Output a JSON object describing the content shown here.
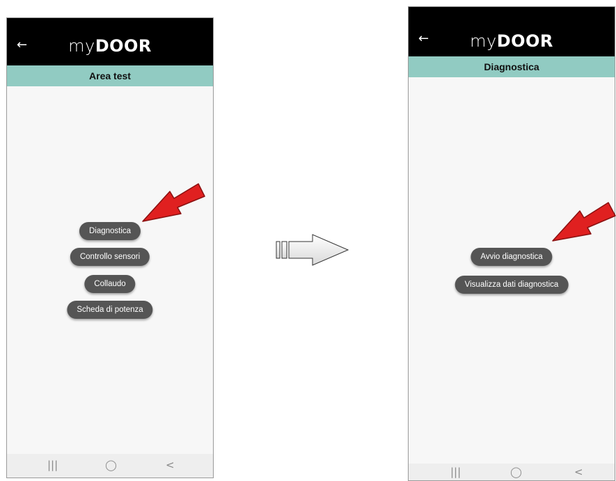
{
  "brand": {
    "my": "my",
    "door": "DOOR"
  },
  "left_screen": {
    "title": "Area test",
    "buttons": [
      "Diagnostica",
      "Controllo sensori",
      "Collaudo",
      "Scheda di potenza"
    ]
  },
  "right_screen": {
    "title": "Diagnostica",
    "buttons": [
      "Avvio diagnostica",
      "Visualizza dati diagnostica"
    ]
  },
  "nav_glyphs": {
    "recents": "|||",
    "home": "◯",
    "back": "<"
  },
  "icons": {
    "back": "arrow-left-icon",
    "transition": "arrow-right-icon",
    "pointer": "red-arrow-icon"
  },
  "colors": {
    "header": "#000000",
    "subheader": "#91cbc2",
    "button": "#555555",
    "arrow_red": "#e02020"
  }
}
